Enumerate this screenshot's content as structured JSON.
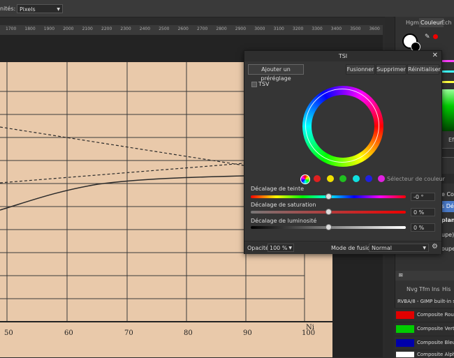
{
  "toolbar": {
    "units_label": "nités:",
    "units_value": "Pixels"
  },
  "ruler": {
    "ticks": [
      "1700",
      "1800",
      "1900",
      "2000",
      "2100",
      "2200",
      "2300",
      "2400",
      "2500",
      "2600",
      "2700",
      "2800",
      "2900",
      "3000",
      "3100",
      "3200",
      "3300",
      "3400",
      "3500",
      "3600"
    ]
  },
  "chart_data": {
    "type": "line",
    "x_tick_labels": [
      "50",
      "60",
      "70",
      "80",
      "90",
      "100"
    ],
    "x_axis_label": "Ni"
  },
  "right_panel": {
    "tabs": [
      "Hgm",
      "Couleur",
      "Éch"
    ],
    "fragments": [
      "e Coul",
      "s Dég",
      "plan",
      "upe)",
      "oupe)",
      "es",
      "Eff"
    ],
    "layer_tabs": [
      "Nvg",
      "Tfm",
      "Ins",
      "His"
    ],
    "layer_header": "RVBA/8 - GIMP built-in s",
    "layers": [
      {
        "name": "Composite Roug",
        "color": "#e00000"
      },
      {
        "name": "Composite Vert",
        "color": "#00cc00"
      },
      {
        "name": "Composite Bleu",
        "color": "#0000aa"
      },
      {
        "name": "Composite Alph",
        "color": "#ffffff"
      }
    ]
  },
  "dialog": {
    "title": "TSI",
    "preset_button": "Ajouter un préréglage",
    "merge_button": "Fusionner",
    "delete_button": "Supprimer",
    "reset_button": "Réinitialiser",
    "tsv_label": "TSV",
    "color_picker_label": "Sélecteur de couleur",
    "swatches": [
      "#e02020",
      "#f0e000",
      "#20c020",
      "#10e0e0",
      "#2020e0",
      "#e020e0"
    ],
    "hue": {
      "label": "Décalage de teinte",
      "value": "-0 °",
      "fraction": 0.5
    },
    "saturation": {
      "label": "Décalage de saturation",
      "value": "0 %",
      "fraction": 0.5
    },
    "luminosity": {
      "label": "Décalage de luminosité",
      "value": "0 %",
      "fraction": 0.5
    },
    "opacity_label": "Opacité:",
    "opacity_value": "100 %",
    "blend_label": "Mode de fusion:",
    "blend_value": "Normal"
  }
}
